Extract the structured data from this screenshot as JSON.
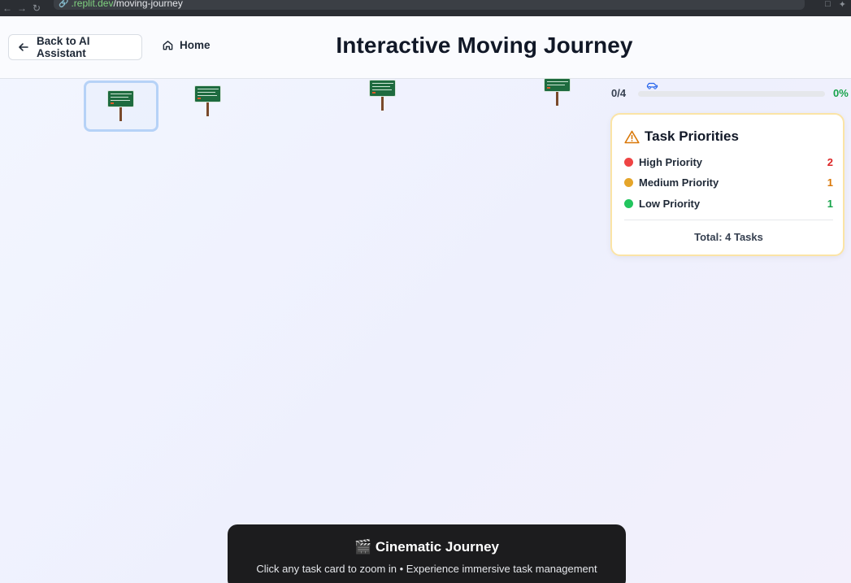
{
  "browser": {
    "back_icon": "arrow-left-icon",
    "forward_icon": "arrow-right-icon",
    "reload_icon": "reload-icon",
    "url_host": ".replit.dev",
    "url_path": "/moving-journey"
  },
  "header": {
    "back_label": "Back to AI Assistant",
    "home_label": "Home",
    "title": "Interactive Moving Journey"
  },
  "progress": {
    "count": "0/4",
    "percent_label": "0%",
    "fraction_complete": 0
  },
  "priorities": {
    "title": "Task Priorities",
    "items": [
      {
        "label": "High Priority",
        "count": "2",
        "color": "#ef4444",
        "count_color": "#dc2626"
      },
      {
        "label": "Medium Priority",
        "count": "1",
        "color": "#e5a52a",
        "count_color": "#d97706"
      },
      {
        "label": "Low Priority",
        "count": "1",
        "color": "#22c55e",
        "count_color": "#16a34a"
      }
    ],
    "total": "Total: 4 Tasks"
  },
  "cinema": {
    "title": "🎬 Cinematic Journey",
    "subtitle": "Click any task card to zoom in • Experience immersive task management"
  },
  "colors": {
    "accent_blue": "#2563eb",
    "sign_green": "#1e6b3f",
    "sign_post": "#7a4a2b",
    "warning": "#d97706"
  }
}
